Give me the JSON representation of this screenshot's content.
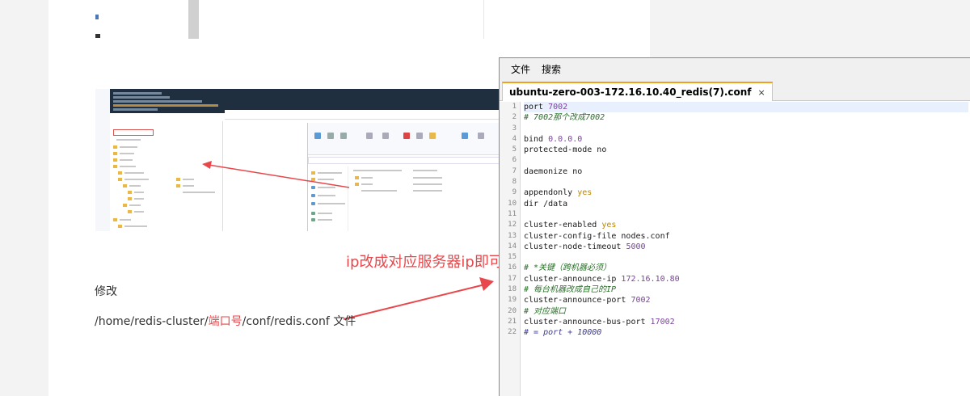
{
  "document": {
    "paragraph_edit": "修改",
    "path_prefix": "/home/redis-cluster/",
    "path_highlight": "端口号",
    "path_suffix": "/conf/redis.conf 文件",
    "annotation": "ip改成对应服务器ip即可"
  },
  "editor": {
    "menu": [
      "文件",
      "搜索"
    ],
    "tab_title": "ubuntu-zero-003-172.16.10.40_redis(7).conf",
    "tab_close": "×",
    "lines": [
      {
        "n": "1",
        "parts": [
          {
            "t": "port ",
            "c": ""
          },
          {
            "t": "7002",
            "c": "num"
          }
        ]
      },
      {
        "n": "2",
        "parts": [
          {
            "t": "# 7002那个改成7002",
            "c": "cm"
          }
        ]
      },
      {
        "n": "3",
        "parts": []
      },
      {
        "n": "4",
        "parts": [
          {
            "t": "bind ",
            "c": ""
          },
          {
            "t": "0.0.0.0",
            "c": "num"
          }
        ]
      },
      {
        "n": "5",
        "parts": [
          {
            "t": "protected-mode no",
            "c": ""
          }
        ]
      },
      {
        "n": "6",
        "parts": []
      },
      {
        "n": "7",
        "parts": [
          {
            "t": "daemonize no",
            "c": ""
          }
        ]
      },
      {
        "n": "8",
        "parts": []
      },
      {
        "n": "9",
        "parts": [
          {
            "t": "appendonly ",
            "c": ""
          },
          {
            "t": "yes",
            "c": "kw"
          }
        ]
      },
      {
        "n": "10",
        "parts": [
          {
            "t": "dir /data",
            "c": ""
          }
        ]
      },
      {
        "n": "11",
        "parts": []
      },
      {
        "n": "12",
        "parts": [
          {
            "t": "cluster-enabled ",
            "c": ""
          },
          {
            "t": "yes",
            "c": "kw"
          }
        ]
      },
      {
        "n": "13",
        "parts": [
          {
            "t": "cluster-config-file nodes.conf",
            "c": ""
          }
        ]
      },
      {
        "n": "14",
        "parts": [
          {
            "t": "cluster-node-timeout ",
            "c": ""
          },
          {
            "t": "5000",
            "c": "num"
          }
        ]
      },
      {
        "n": "15",
        "parts": []
      },
      {
        "n": "16",
        "parts": [
          {
            "t": "# *关键（跨机器必须）",
            "c": "cm"
          }
        ]
      },
      {
        "n": "17",
        "parts": [
          {
            "t": "cluster-announce-ip ",
            "c": ""
          },
          {
            "t": "172.16.10.80",
            "c": "num"
          }
        ]
      },
      {
        "n": "18",
        "parts": [
          {
            "t": "# 每台机器改成自己的IP",
            "c": "cm"
          }
        ]
      },
      {
        "n": "19",
        "parts": [
          {
            "t": "cluster-announce-port ",
            "c": ""
          },
          {
            "t": "7002",
            "c": "num"
          }
        ]
      },
      {
        "n": "20",
        "parts": [
          {
            "t": "# 对应端口",
            "c": "cm"
          }
        ]
      },
      {
        "n": "21",
        "parts": [
          {
            "t": "cluster-announce-bus-port ",
            "c": ""
          },
          {
            "t": "17002",
            "c": "num"
          }
        ]
      },
      {
        "n": "22",
        "parts": [
          {
            "t": "# = port + 10000",
            "c": "cm-blue"
          }
        ]
      }
    ]
  },
  "colors": {
    "annotation_red": "#e8474b",
    "tab_accent": "#f0a020"
  }
}
